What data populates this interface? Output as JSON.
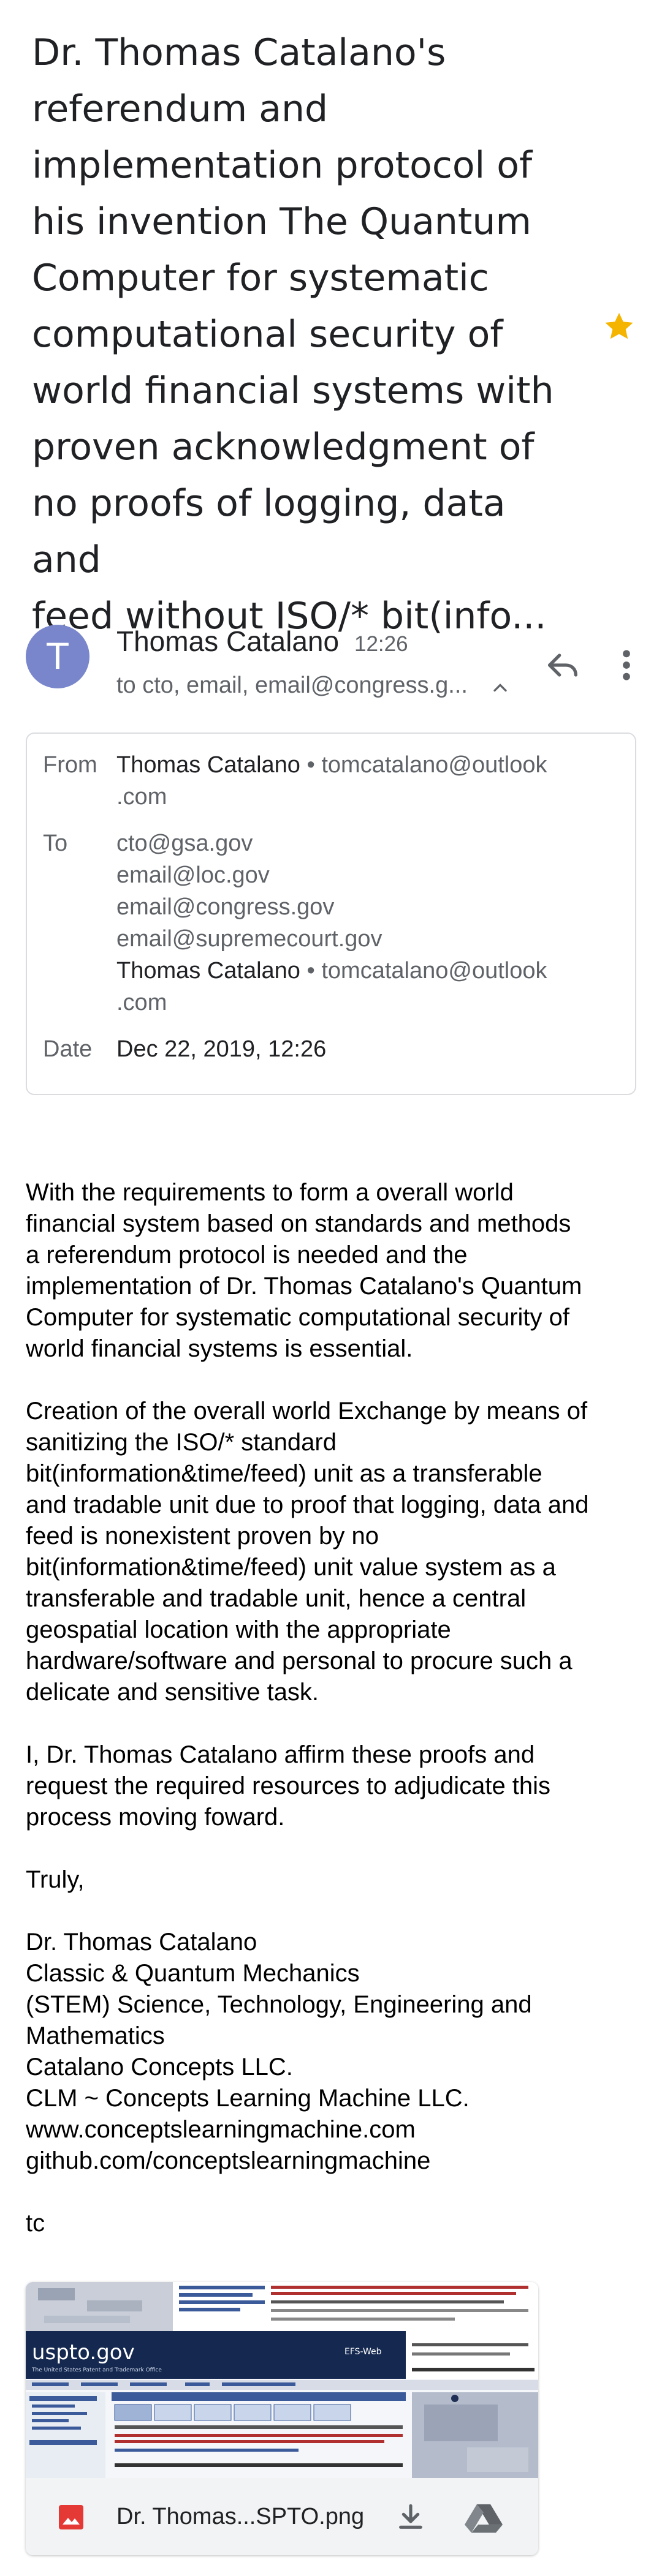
{
  "email": {
    "subject_lines": [
      "Dr. Thomas Catalano's",
      "referendum and",
      "implementation protocol of",
      "his invention The Quantum",
      "Computer for systematic",
      "computational security of",
      "world financial systems with",
      "proven acknowledgment of",
      "no proofs of logging, data and",
      "feed without ISO/* bit(info..."
    ],
    "starred": true,
    "colors": {
      "star": "#f4b400",
      "avatar": "#7986cb",
      "attachment_icon": "#e53935"
    },
    "sender": {
      "avatar_letter": "T",
      "name": "Thomas Catalano",
      "time": "12:26",
      "recipients_summary": "to cto, email, email@congress.g..."
    },
    "details": {
      "from_label": "From",
      "from_name": "Thomas Catalano",
      "from_email_line1": " • tomcatalano@outlook",
      "from_email_line2": ".com",
      "to_label": "To",
      "to": [
        "cto@gsa.gov",
        "email@loc.gov",
        "email@congress.gov",
        "email@supremecourt.gov"
      ],
      "to_last_name": "Thomas Catalano",
      "to_last_email_line1": " • tomcatalano@outlook",
      "to_last_email_line2": ".com",
      "date_label": "Date",
      "date": "Dec 22, 2019, 12:26"
    },
    "body": {
      "p1": [
        "With the requirements to form a overall world",
        "financial system based on standards and methods",
        "a referendum protocol is needed and the",
        "implementation of Dr. Thomas Catalano's Quantum",
        "Computer for systematic computational security of",
        "world financial systems is essential."
      ],
      "p2": [
        "Creation of the overall world Exchange by means of",
        "sanitizing the ISO/* standard",
        "bit(information&time/feed) unit as a transferable",
        "and tradable unit due to proof that logging, data and",
        "feed is nonexistent proven by no",
        "bit(information&time/feed) unit value system as a",
        "transferable and tradable unit, hence a central",
        "geospatial location with the appropriate",
        "hardware/software and personal to procure such a",
        "delicate and sensitive task."
      ],
      "p3": [
        "I, Dr. Thomas Catalano affirm these proofs and",
        "request the required resources to adjudicate this",
        "process moving foward."
      ],
      "closing": "Truly,",
      "signature": [
        "Dr. Thomas Catalano",
        "Classic & Quantum Mechanics",
        "(STEM) Science, Technology, Engineering and",
        "Mathematics",
        "Catalano Concepts LLC.",
        "CLM ~ Concepts Learning Machine LLC.",
        "www.conceptslearningmachine.com",
        "github.com/conceptslearningmachine"
      ],
      "initials": "tc"
    },
    "attachment": {
      "filename": "Dr. Thomas...SPTO.png",
      "thumbnail_text": {
        "logo": "uspto.gov",
        "tagline": "The United States Patent and Trademark Office",
        "badge": "EFS-Web"
      },
      "icons": [
        "image-icon",
        "download-icon",
        "drive-icon"
      ]
    }
  }
}
